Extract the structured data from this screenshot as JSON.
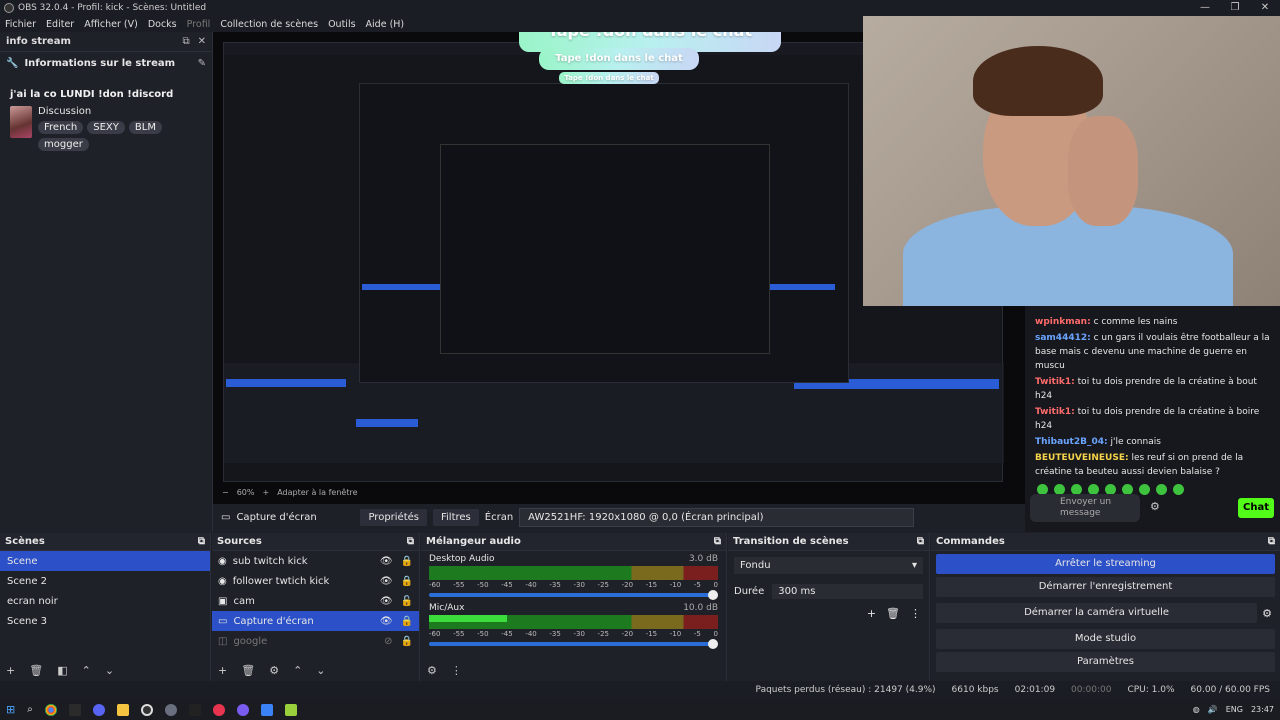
{
  "window": {
    "title": "OBS 32.0.4 - Profil: kick - Scènes: Untitled",
    "controls": [
      "—",
      "❐",
      "✕"
    ]
  },
  "menu": [
    "Fichier",
    "Editer",
    "Afficher (V)",
    "Docks",
    "Profil",
    "Collection de scènes",
    "Outils",
    "Aide (H)"
  ],
  "info_dock": {
    "title": "info stream",
    "header": "Informations sur le stream",
    "stream_title": "j'ai la co LUNDI !don !discord",
    "category": "Discussion",
    "tags": [
      "French",
      "SEXY",
      "BLM",
      "mogger"
    ]
  },
  "overlay": {
    "banner": "Tape !don dans le chat"
  },
  "chat": {
    "messages": [
      {
        "user": "wpinkman:",
        "text": " c comme les nains",
        "color": "red"
      },
      {
        "user": "sam44412:",
        "text": " c un gars il voulais être footballeur a la base mais c devenu une machine de guerre en muscu",
        "color": "blue"
      },
      {
        "user": "Twitik1:",
        "text": " toi tu dois prendre de la créatine à bout h24",
        "color": "red"
      },
      {
        "user": "Twitik1:",
        "text": " toi tu dois prendre de la créatine à boire h24",
        "color": "red"
      },
      {
        "user": "Thibaut2B_04:",
        "text": " j'le connais",
        "color": "blue"
      },
      {
        "user": "BEUTEUVEINEUSE:",
        "text": " les reuf si on prend de la créatine ta beuteu aussi devien balaise ?",
        "color": "yellow"
      }
    ],
    "input_placeholder": "Envoyer un message",
    "send_label": "Chat"
  },
  "preview_controls": {
    "zoom": "60%",
    "fit": "Adapter à la fenêtre"
  },
  "source_bar": {
    "source_name": "Capture d'écran",
    "properties": "Propriétés",
    "filters": "Filtres",
    "display_label": "Écran",
    "display_value": "AW2521HF: 1920x1080 @ 0,0 (Écran principal)"
  },
  "scenes": {
    "title": "Scènes",
    "items": [
      "Scene",
      "Scene 2",
      "ecran noir",
      "Scene 3"
    ],
    "selected": 0
  },
  "sources": {
    "title": "Sources",
    "items": [
      {
        "name": "sub twitch kick",
        "icon": "media-icon"
      },
      {
        "name": "follower twtich kick",
        "icon": "media-icon"
      },
      {
        "name": "cam",
        "icon": "camera-icon"
      },
      {
        "name": "Capture d'écran",
        "icon": "monitor-icon"
      },
      {
        "name": "google",
        "icon": "browser-icon"
      }
    ],
    "selected": 3
  },
  "mixer": {
    "title": "Mélangeur audio",
    "channels": [
      {
        "name": "Desktop Audio",
        "db": "3.0 dB",
        "level": 0.0
      },
      {
        "name": "Mic/Aux",
        "db": "10.0 dB",
        "level": 0.27
      }
    ],
    "scale": [
      "-60",
      "-55",
      "-50",
      "-45",
      "-40",
      "-35",
      "-30",
      "-25",
      "-20",
      "-15",
      "-10",
      "-5",
      "0"
    ]
  },
  "transitions": {
    "title": "Transition de scènes",
    "type": "Fondu",
    "duration_label": "Durée",
    "duration_value": "300 ms"
  },
  "commands": {
    "title": "Commandes",
    "buttons": [
      "Arrêter le streaming",
      "Démarrer l'enregistrement",
      "Démarrer la caméra virtuelle",
      "Mode studio",
      "Paramètres"
    ]
  },
  "status": {
    "dropped": "Paquets perdus (réseau) : 21497 (4.9%)",
    "bitrate": "6610 kbps",
    "stream_time": "02:01:09",
    "rec_time": "00:00:00",
    "cpu": "CPU: 1.0%",
    "fps": "60.00 / 60.00 FPS"
  },
  "taskbar": {
    "lang": "ENG",
    "time": "23:47"
  },
  "colors": {
    "accent": "#2b50c8",
    "kick_green": "#53fc18",
    "meter_green": "#3ddc3d"
  }
}
